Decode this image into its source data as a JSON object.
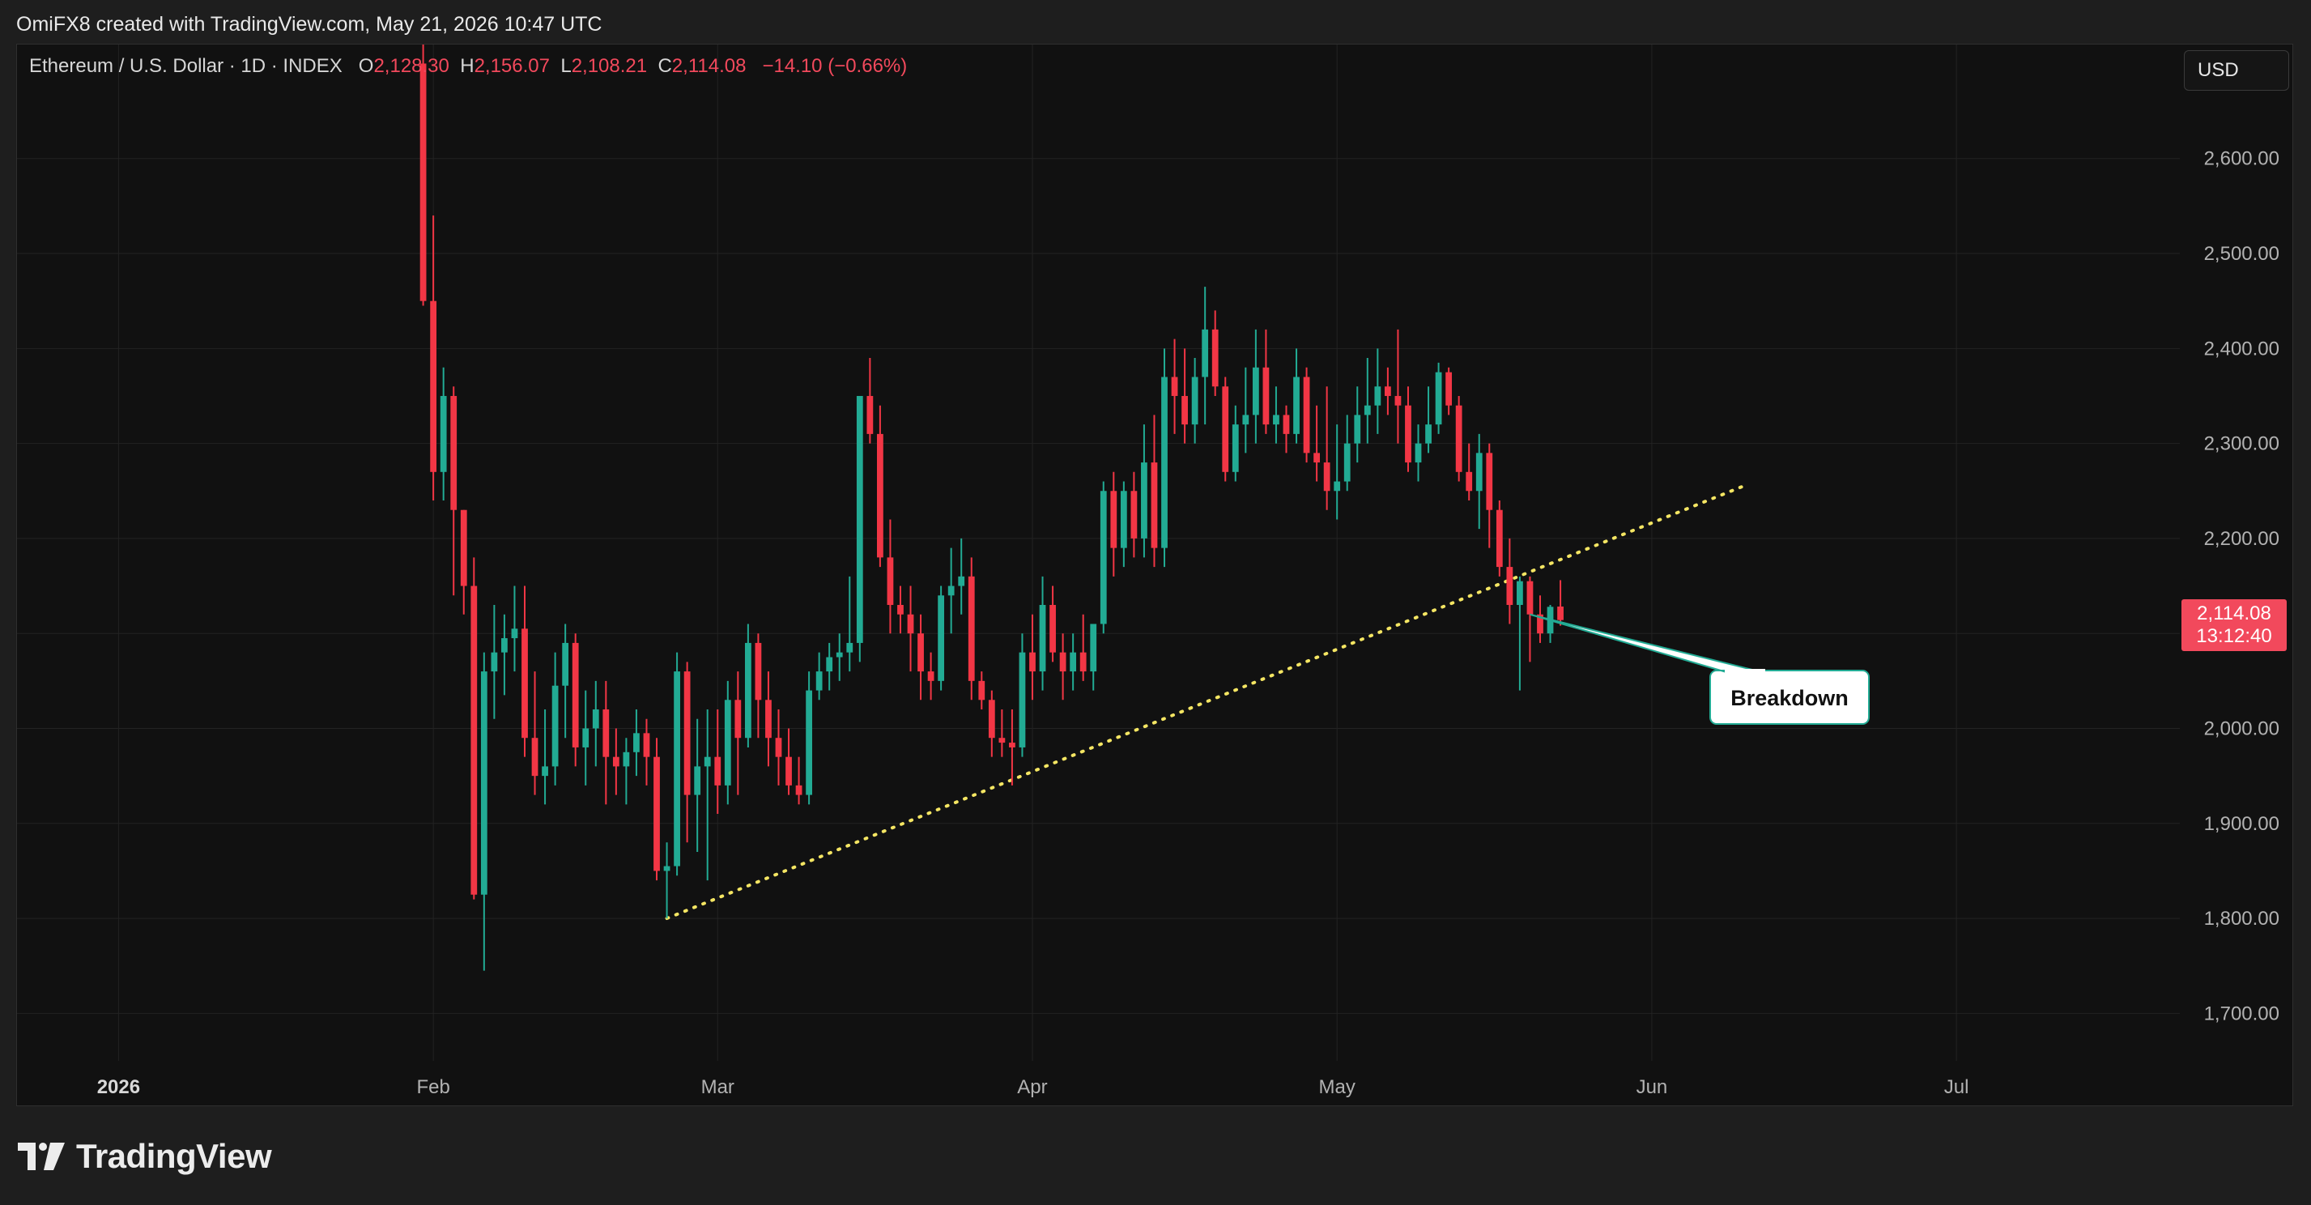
{
  "header": {
    "credit": "OmiFX8 created with TradingView.com, May 21, 2026 10:47 UTC"
  },
  "legend": {
    "symbol": "Ethereum / U.S. Dollar · 1D · INDEX",
    "open_label": "O",
    "open": "2,128.30",
    "high_label": "H",
    "high": "2,156.07",
    "low_label": "L",
    "low": "2,108.21",
    "close_label": "C",
    "close": "2,114.08",
    "change": "−14.10 (−0.66%)"
  },
  "currency_button": "USD",
  "price_tag": {
    "price": "2,114.08",
    "countdown": "13:12:40"
  },
  "brand": {
    "name": "TradingView",
    "icon": "tradingview-logo-icon"
  },
  "colors": {
    "up": "#22ab94",
    "down": "#f23645",
    "trendline": "#f5e663",
    "background": "#111111",
    "grid": "#232323",
    "axis_text": "#b2b2b2"
  },
  "chart_data": {
    "type": "candlestick",
    "y_axis": {
      "position": "right",
      "range": [
        1650,
        2720
      ],
      "ticks": [
        1700,
        1800,
        1900,
        2000,
        2100,
        2200,
        2300,
        2400,
        2500,
        2600
      ],
      "tick_labels": [
        "1,700.00",
        "1,800.00",
        "1,900.00",
        "2,000.00",
        "2,100.00",
        "2,200.00",
        "2,300.00",
        "2,400.00",
        "2,500.00",
        "2,600.00"
      ]
    },
    "x_axis": {
      "range": [
        "2025-12-22",
        "2026-07-23"
      ],
      "ticks": [
        {
          "date": "2026-01-01",
          "label": "2026",
          "bold": true
        },
        {
          "date": "2026-02-01",
          "label": "Feb"
        },
        {
          "date": "2026-03-01",
          "label": "Mar"
        },
        {
          "date": "2026-04-01",
          "label": "Apr"
        },
        {
          "date": "2026-05-01",
          "label": "May"
        },
        {
          "date": "2026-06-01",
          "label": "Jun"
        },
        {
          "date": "2026-07-01",
          "label": "Jul"
        }
      ]
    },
    "grid": true,
    "series_start_date": "2026-01-31",
    "candles": [
      [
        2700,
        2720,
        2445,
        2450
      ],
      [
        2450,
        2540,
        2240,
        2270
      ],
      [
        2270,
        2380,
        2240,
        2350
      ],
      [
        2350,
        2360,
        2140,
        2230
      ],
      [
        2230,
        2230,
        2120,
        2150
      ],
      [
        2150,
        2180,
        1820,
        1825
      ],
      [
        1825,
        2080,
        1745,
        2060
      ],
      [
        2060,
        2130,
        2010,
        2080
      ],
      [
        2080,
        2120,
        2035,
        2095
      ],
      [
        2095,
        2150,
        2060,
        2105
      ],
      [
        2105,
        2150,
        1970,
        1990
      ],
      [
        1990,
        2060,
        1930,
        1950
      ],
      [
        1950,
        2020,
        1920,
        1960
      ],
      [
        1960,
        2080,
        1940,
        2045
      ],
      [
        2045,
        2110,
        1990,
        2090
      ],
      [
        2090,
        2100,
        1960,
        1980
      ],
      [
        1980,
        2040,
        1940,
        2000
      ],
      [
        2000,
        2050,
        1960,
        2020
      ],
      [
        2020,
        2050,
        1920,
        1970
      ],
      [
        1970,
        2000,
        1930,
        1960
      ],
      [
        1960,
        1990,
        1920,
        1975
      ],
      [
        1975,
        2020,
        1950,
        1995
      ],
      [
        1995,
        2010,
        1940,
        1970
      ],
      [
        1970,
        1990,
        1840,
        1850
      ],
      [
        1850,
        1880,
        1800,
        1855
      ],
      [
        1855,
        2080,
        1845,
        2060
      ],
      [
        2060,
        2070,
        1880,
        1930
      ],
      [
        1930,
        2010,
        1870,
        1960
      ],
      [
        1960,
        2020,
        1840,
        1970
      ],
      [
        1970,
        2020,
        1910,
        1940
      ],
      [
        1940,
        2050,
        1920,
        2030
      ],
      [
        2030,
        2060,
        1930,
        1990
      ],
      [
        1990,
        2110,
        1980,
        2090
      ],
      [
        2090,
        2100,
        1990,
        2030
      ],
      [
        2030,
        2060,
        1960,
        1990
      ],
      [
        1990,
        2020,
        1940,
        1970
      ],
      [
        1970,
        2000,
        1930,
        1940
      ],
      [
        1940,
        1970,
        1920,
        1930
      ],
      [
        1930,
        2060,
        1920,
        2040
      ],
      [
        2040,
        2080,
        2030,
        2060
      ],
      [
        2060,
        2090,
        2040,
        2075
      ],
      [
        2075,
        2100,
        2050,
        2080
      ],
      [
        2080,
        2160,
        2060,
        2090
      ],
      [
        2090,
        2340,
        2070,
        2350
      ],
      [
        2350,
        2390,
        2300,
        2310
      ],
      [
        2310,
        2340,
        2170,
        2180
      ],
      [
        2180,
        2220,
        2100,
        2130
      ],
      [
        2130,
        2150,
        2100,
        2120
      ],
      [
        2120,
        2150,
        2060,
        2100
      ],
      [
        2100,
        2120,
        2030,
        2060
      ],
      [
        2060,
        2080,
        2030,
        2050
      ],
      [
        2050,
        2150,
        2040,
        2140
      ],
      [
        2140,
        2190,
        2100,
        2150
      ],
      [
        2150,
        2200,
        2120,
        2160
      ],
      [
        2160,
        2180,
        2030,
        2050
      ],
      [
        2050,
        2060,
        2020,
        2030
      ],
      [
        2030,
        2040,
        1970,
        1990
      ],
      [
        1990,
        2020,
        1970,
        1985
      ],
      [
        1985,
        2020,
        1940,
        1980
      ],
      [
        1980,
        2100,
        1970,
        2080
      ],
      [
        2080,
        2120,
        2030,
        2060
      ],
      [
        2060,
        2160,
        2040,
        2130
      ],
      [
        2130,
        2150,
        2070,
        2080
      ],
      [
        2080,
        2100,
        2030,
        2060
      ],
      [
        2060,
        2100,
        2040,
        2080
      ],
      [
        2080,
        2120,
        2050,
        2060
      ],
      [
        2060,
        2110,
        2040,
        2110
      ],
      [
        2110,
        2260,
        2100,
        2250
      ],
      [
        2250,
        2270,
        2160,
        2190
      ],
      [
        2190,
        2260,
        2170,
        2250
      ],
      [
        2250,
        2270,
        2180,
        2200
      ],
      [
        2200,
        2320,
        2180,
        2280
      ],
      [
        2280,
        2330,
        2170,
        2190
      ],
      [
        2190,
        2400,
        2170,
        2370
      ],
      [
        2370,
        2410,
        2310,
        2350
      ],
      [
        2350,
        2400,
        2300,
        2320
      ],
      [
        2320,
        2390,
        2300,
        2370
      ],
      [
        2370,
        2465,
        2320,
        2420
      ],
      [
        2420,
        2440,
        2350,
        2360
      ],
      [
        2360,
        2370,
        2260,
        2270
      ],
      [
        2270,
        2340,
        2260,
        2320
      ],
      [
        2320,
        2380,
        2290,
        2330
      ],
      [
        2330,
        2420,
        2300,
        2380
      ],
      [
        2380,
        2420,
        2310,
        2320
      ],
      [
        2320,
        2360,
        2300,
        2330
      ],
      [
        2330,
        2340,
        2290,
        2310
      ],
      [
        2310,
        2400,
        2300,
        2370
      ],
      [
        2370,
        2380,
        2280,
        2290
      ],
      [
        2290,
        2340,
        2260,
        2280
      ],
      [
        2280,
        2360,
        2230,
        2250
      ],
      [
        2250,
        2320,
        2220,
        2260
      ],
      [
        2260,
        2330,
        2250,
        2300
      ],
      [
        2300,
        2360,
        2280,
        2330
      ],
      [
        2330,
        2390,
        2300,
        2340
      ],
      [
        2340,
        2400,
        2310,
        2360
      ],
      [
        2360,
        2380,
        2330,
        2350
      ],
      [
        2350,
        2420,
        2300,
        2340
      ],
      [
        2340,
        2360,
        2270,
        2280
      ],
      [
        2280,
        2320,
        2260,
        2300
      ],
      [
        2300,
        2360,
        2290,
        2320
      ],
      [
        2320,
        2385,
        2310,
        2375
      ],
      [
        2375,
        2380,
        2330,
        2340
      ],
      [
        2340,
        2350,
        2260,
        2270
      ],
      [
        2270,
        2300,
        2240,
        2250
      ],
      [
        2250,
        2310,
        2210,
        2290
      ],
      [
        2290,
        2300,
        2190,
        2230
      ],
      [
        2230,
        2240,
        2160,
        2170
      ],
      [
        2170,
        2200,
        2110,
        2130
      ],
      [
        2130,
        2160,
        2040,
        2155
      ],
      [
        2155,
        2160,
        2070,
        2120
      ],
      [
        2120,
        2140,
        2090,
        2100
      ],
      [
        2100,
        2130,
        2090,
        2128
      ],
      [
        2128.3,
        2156.07,
        2108.21,
        2114.08
      ]
    ],
    "annotations": [
      {
        "type": "trendline",
        "style": "dotted",
        "from": {
          "date": "2026-02-24",
          "price": 1800
        },
        "to": {
          "date": "2026-06-10",
          "price": 2255
        }
      },
      {
        "type": "callout",
        "text": "Breakdown",
        "anchor": {
          "date": "2026-05-20",
          "price": 2120
        }
      }
    ],
    "last_price_marker": {
      "price": 2114.08,
      "label": "2,114.08",
      "countdown": "13:12:40"
    }
  }
}
